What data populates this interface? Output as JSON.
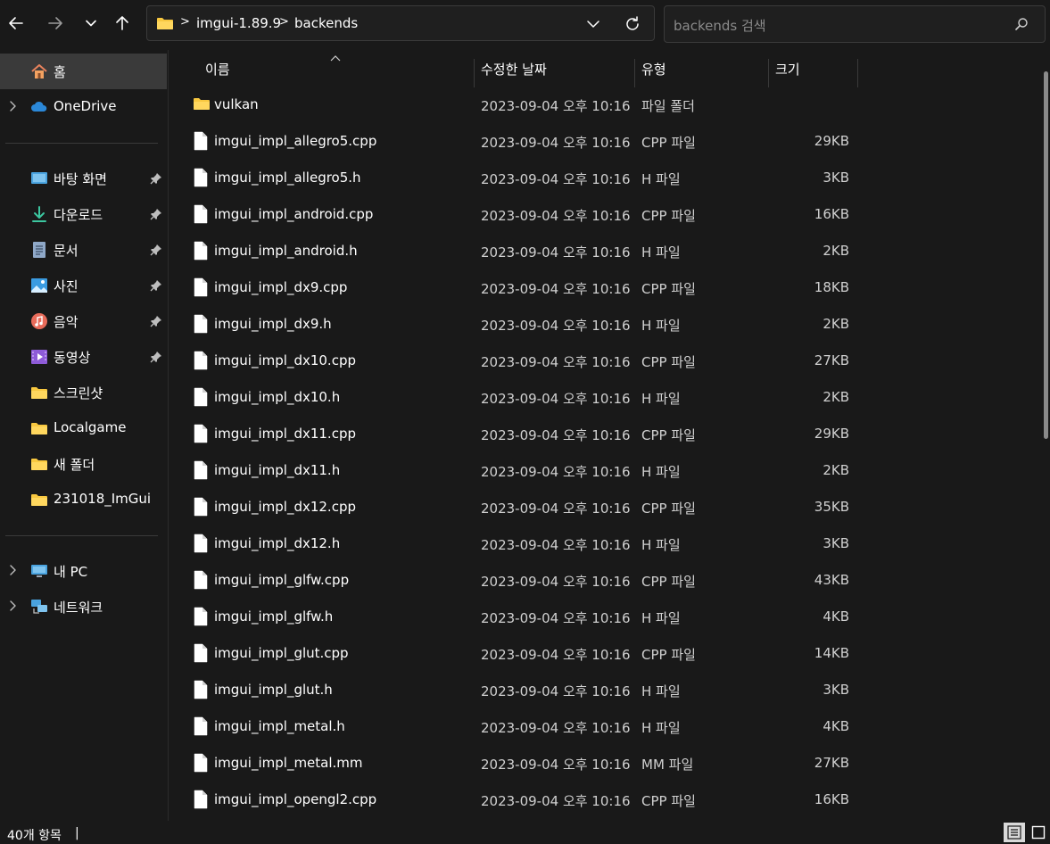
{
  "colors": {
    "background": "#191919",
    "selected": "#3a3a3a",
    "folder": "#f8c840",
    "accent": "#4aa3df"
  },
  "toolbar": {
    "back_icon": "arrow-left-icon",
    "forward_icon": "arrow-right-icon",
    "recent_icon": "chevron-down-icon",
    "up_icon": "arrow-up-icon"
  },
  "address": {
    "crumbs": [
      "imgui-1.89.9",
      "backends"
    ],
    "separator": ">"
  },
  "search": {
    "placeholder": "backends 검색",
    "icon": "search-icon"
  },
  "sidebar": {
    "home": {
      "label": "홈",
      "icon": "home-icon"
    },
    "onedrive": {
      "label": "OneDrive",
      "icon": "cloud-icon"
    },
    "quick": [
      {
        "label": "바탕 화면",
        "icon": "desktop-icon",
        "pinned": true
      },
      {
        "label": "다운로드",
        "icon": "download-icon",
        "pinned": true
      },
      {
        "label": "문서",
        "icon": "document-icon",
        "pinned": true
      },
      {
        "label": "사진",
        "icon": "pictures-icon",
        "pinned": true
      },
      {
        "label": "음악",
        "icon": "music-icon",
        "pinned": true
      },
      {
        "label": "동영상",
        "icon": "video-icon",
        "pinned": true
      },
      {
        "label": "스크린샷",
        "icon": "folder-icon",
        "pinned": false
      },
      {
        "label": "Localgame",
        "icon": "folder-icon",
        "pinned": false
      },
      {
        "label": "새 폴더",
        "icon": "folder-icon",
        "pinned": false
      },
      {
        "label": "231018_ImGui",
        "icon": "folder-icon",
        "pinned": false
      }
    ],
    "thispc": {
      "label": "내 PC",
      "icon": "computer-icon"
    },
    "network": {
      "label": "네트워크",
      "icon": "network-icon"
    }
  },
  "columns": {
    "name": "이름",
    "date": "수정한 날짜",
    "type": "유형",
    "size": "크기"
  },
  "files": [
    {
      "name": "vulkan",
      "date": "2023-09-04 오후 10:16",
      "type": "파일 폴더",
      "size": "",
      "kind": "folder"
    },
    {
      "name": "imgui_impl_allegro5.cpp",
      "date": "2023-09-04 오후 10:16",
      "type": "CPP 파일",
      "size": "29KB",
      "kind": "file"
    },
    {
      "name": "imgui_impl_allegro5.h",
      "date": "2023-09-04 오후 10:16",
      "type": "H 파일",
      "size": "3KB",
      "kind": "file"
    },
    {
      "name": "imgui_impl_android.cpp",
      "date": "2023-09-04 오후 10:16",
      "type": "CPP 파일",
      "size": "16KB",
      "kind": "file"
    },
    {
      "name": "imgui_impl_android.h",
      "date": "2023-09-04 오후 10:16",
      "type": "H 파일",
      "size": "2KB",
      "kind": "file"
    },
    {
      "name": "imgui_impl_dx9.cpp",
      "date": "2023-09-04 오후 10:16",
      "type": "CPP 파일",
      "size": "18KB",
      "kind": "file"
    },
    {
      "name": "imgui_impl_dx9.h",
      "date": "2023-09-04 오후 10:16",
      "type": "H 파일",
      "size": "2KB",
      "kind": "file"
    },
    {
      "name": "imgui_impl_dx10.cpp",
      "date": "2023-09-04 오후 10:16",
      "type": "CPP 파일",
      "size": "27KB",
      "kind": "file"
    },
    {
      "name": "imgui_impl_dx10.h",
      "date": "2023-09-04 오후 10:16",
      "type": "H 파일",
      "size": "2KB",
      "kind": "file"
    },
    {
      "name": "imgui_impl_dx11.cpp",
      "date": "2023-09-04 오후 10:16",
      "type": "CPP 파일",
      "size": "29KB",
      "kind": "file"
    },
    {
      "name": "imgui_impl_dx11.h",
      "date": "2023-09-04 오후 10:16",
      "type": "H 파일",
      "size": "2KB",
      "kind": "file"
    },
    {
      "name": "imgui_impl_dx12.cpp",
      "date": "2023-09-04 오후 10:16",
      "type": "CPP 파일",
      "size": "35KB",
      "kind": "file"
    },
    {
      "name": "imgui_impl_dx12.h",
      "date": "2023-09-04 오후 10:16",
      "type": "H 파일",
      "size": "3KB",
      "kind": "file"
    },
    {
      "name": "imgui_impl_glfw.cpp",
      "date": "2023-09-04 오후 10:16",
      "type": "CPP 파일",
      "size": "43KB",
      "kind": "file"
    },
    {
      "name": "imgui_impl_glfw.h",
      "date": "2023-09-04 오후 10:16",
      "type": "H 파일",
      "size": "4KB",
      "kind": "file"
    },
    {
      "name": "imgui_impl_glut.cpp",
      "date": "2023-09-04 오후 10:16",
      "type": "CPP 파일",
      "size": "14KB",
      "kind": "file"
    },
    {
      "name": "imgui_impl_glut.h",
      "date": "2023-09-04 오후 10:16",
      "type": "H 파일",
      "size": "3KB",
      "kind": "file"
    },
    {
      "name": "imgui_impl_metal.h",
      "date": "2023-09-04 오후 10:16",
      "type": "H 파일",
      "size": "4KB",
      "kind": "file"
    },
    {
      "name": "imgui_impl_metal.mm",
      "date": "2023-09-04 오후 10:16",
      "type": "MM 파일",
      "size": "27KB",
      "kind": "file"
    },
    {
      "name": "imgui_impl_opengl2.cpp",
      "date": "2023-09-04 오후 10:16",
      "type": "CPP 파일",
      "size": "16KB",
      "kind": "file"
    }
  ],
  "status": {
    "item_count": "40개 항목",
    "separator": "|",
    "details_view_icon": "details-view-icon",
    "tiles_view_icon": "large-icons-view-icon"
  }
}
